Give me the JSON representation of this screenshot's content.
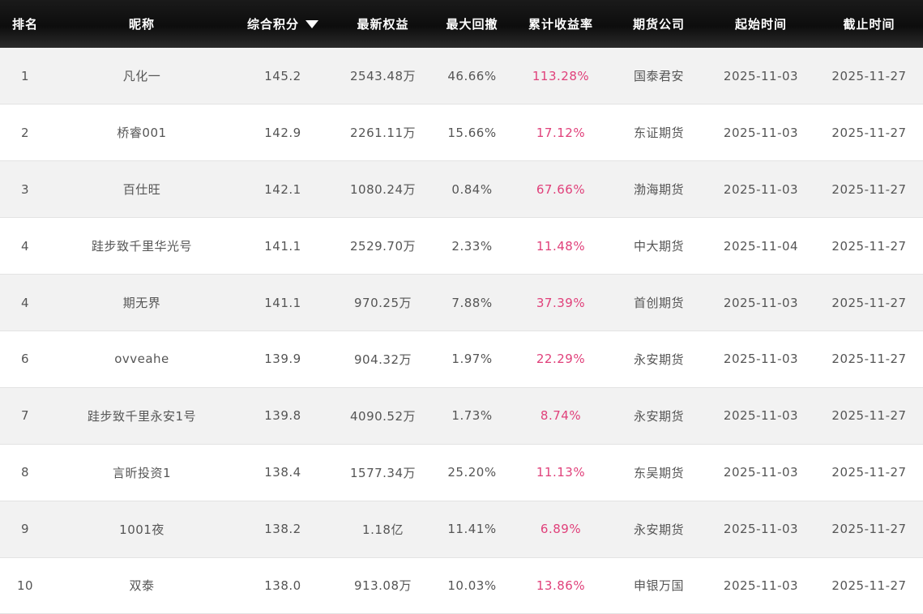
{
  "columns": {
    "rank": "排名",
    "nickname": "昵称",
    "score": "综合积分",
    "equity": "最新权益",
    "drawdown": "最大回撤",
    "return": "累计收益率",
    "company": "期货公司",
    "start": "起始时间",
    "end": "截止时间"
  },
  "sort": {
    "column": "score",
    "direction": "desc",
    "icon": "sort-down-icon"
  },
  "colors": {
    "header_bg": "#111111",
    "return_text": "#e0407a",
    "row_alt_bg": "#f2f2f2",
    "text": "#555555"
  },
  "rows": [
    {
      "rank": "1",
      "nickname": "凡化一",
      "score": "145.2",
      "equity": "2543.48万",
      "drawdown": "46.66%",
      "return": "113.28%",
      "company": "国泰君安",
      "start": "2025-11-03",
      "end": "2025-11-27"
    },
    {
      "rank": "2",
      "nickname": "桥睿001",
      "score": "142.9",
      "equity": "2261.11万",
      "drawdown": "15.66%",
      "return": "17.12%",
      "company": "东证期货",
      "start": "2025-11-03",
      "end": "2025-11-27"
    },
    {
      "rank": "3",
      "nickname": "百仕旺",
      "score": "142.1",
      "equity": "1080.24万",
      "drawdown": "0.84%",
      "return": "67.66%",
      "company": "渤海期货",
      "start": "2025-11-03",
      "end": "2025-11-27"
    },
    {
      "rank": "4",
      "nickname": "跬步致千里华光号",
      "score": "141.1",
      "equity": "2529.70万",
      "drawdown": "2.33%",
      "return": "11.48%",
      "company": "中大期货",
      "start": "2025-11-04",
      "end": "2025-11-27"
    },
    {
      "rank": "4",
      "nickname": "期无界",
      "score": "141.1",
      "equity": "970.25万",
      "drawdown": "7.88%",
      "return": "37.39%",
      "company": "首创期货",
      "start": "2025-11-03",
      "end": "2025-11-27"
    },
    {
      "rank": "6",
      "nickname": "ovveahe",
      "score": "139.9",
      "equity": "904.32万",
      "drawdown": "1.97%",
      "return": "22.29%",
      "company": "永安期货",
      "start": "2025-11-03",
      "end": "2025-11-27"
    },
    {
      "rank": "7",
      "nickname": "跬步致千里永安1号",
      "score": "139.8",
      "equity": "4090.52万",
      "drawdown": "1.73%",
      "return": "8.74%",
      "company": "永安期货",
      "start": "2025-11-03",
      "end": "2025-11-27"
    },
    {
      "rank": "8",
      "nickname": "言昕投资1",
      "score": "138.4",
      "equity": "1577.34万",
      "drawdown": "25.20%",
      "return": "11.13%",
      "company": "东吴期货",
      "start": "2025-11-03",
      "end": "2025-11-27"
    },
    {
      "rank": "9",
      "nickname": "1001夜",
      "score": "138.2",
      "equity": "1.18亿",
      "drawdown": "11.41%",
      "return": "6.89%",
      "company": "永安期货",
      "start": "2025-11-03",
      "end": "2025-11-27"
    },
    {
      "rank": "10",
      "nickname": "双泰",
      "score": "138.0",
      "equity": "913.08万",
      "drawdown": "10.03%",
      "return": "13.86%",
      "company": "申银万国",
      "start": "2025-11-03",
      "end": "2025-11-27"
    }
  ]
}
